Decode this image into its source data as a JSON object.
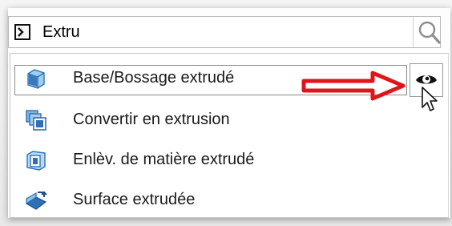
{
  "search": {
    "value": "Extru",
    "cmd_icon": "command-prompt-icon",
    "search_icon": "magnifier-icon"
  },
  "results": [
    {
      "label": "Base/Bossage extrudé",
      "icon": "extruded-boss-icon"
    },
    {
      "label": "Convertir en extrusion",
      "icon": "convert-to-extrusion-icon"
    },
    {
      "label": "Enlèv. de matière extrudé",
      "icon": "extruded-cut-icon"
    },
    {
      "label": "Surface extrudée",
      "icon": "extruded-surface-icon"
    }
  ],
  "hover_tools": {
    "eye_icon": "eye-icon",
    "annotation_arrow": "red-arrow-icon",
    "pointer": "mouse-pointer-icon"
  },
  "colors": {
    "arrow": "#e0141b",
    "icon_blue": "#2f6fb6",
    "icon_light_blue": "#8cc4ee",
    "border": "#b8b8b8"
  }
}
